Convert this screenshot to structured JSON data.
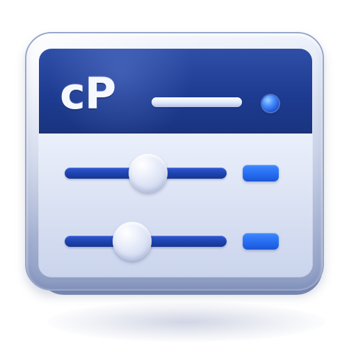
{
  "app_icon": {
    "title_bar": {
      "logo_text": "cP"
    },
    "sliders": [
      {
        "value_fraction": 0.56
      },
      {
        "value_fraction": 0.45
      }
    ],
    "colors": {
      "title_bar": "#1f3d94",
      "track": "#2248bb",
      "accent": "#2c74f6",
      "panel": "#dce3f3",
      "frame": "#c9d2e8"
    }
  }
}
